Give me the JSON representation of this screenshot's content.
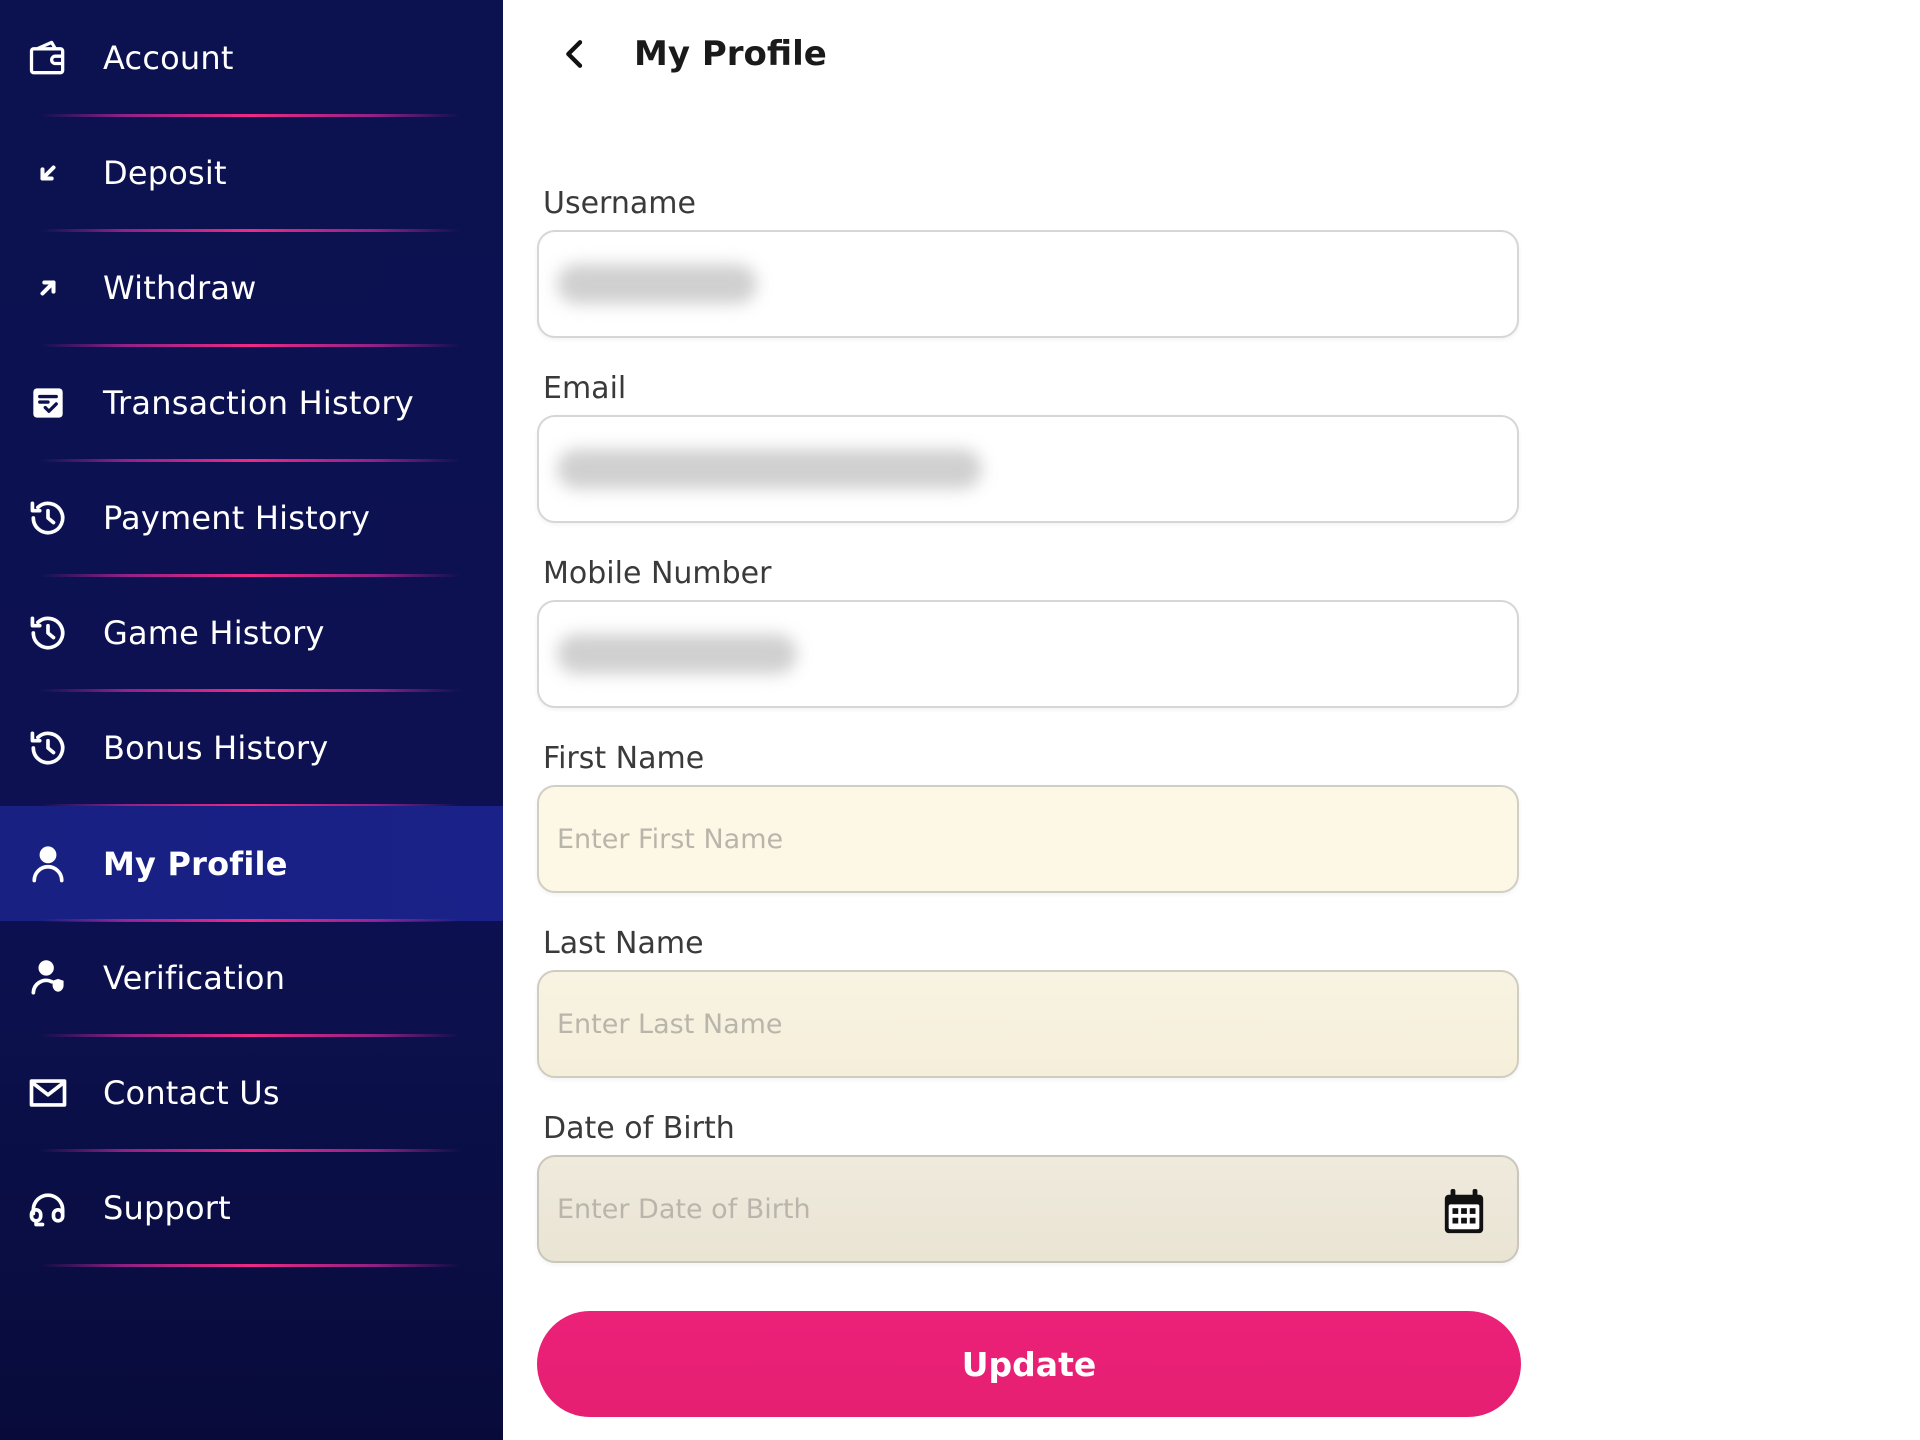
{
  "sidebar": {
    "active_item": "My Profile",
    "items": [
      {
        "label": "Account",
        "icon": "wallet-icon"
      },
      {
        "label": "Deposit",
        "icon": "arrow-down-left-icon"
      },
      {
        "label": "Withdraw",
        "icon": "arrow-up-right-icon"
      },
      {
        "label": "Transaction History",
        "icon": "receipt-check-icon"
      },
      {
        "label": "Payment History",
        "icon": "history-icon"
      },
      {
        "label": "Game History",
        "icon": "history-icon"
      },
      {
        "label": "Bonus History",
        "icon": "history-icon"
      },
      {
        "label": "My Profile",
        "icon": "user-icon"
      },
      {
        "label": "Verification",
        "icon": "user-shield-icon"
      },
      {
        "label": "Contact Us",
        "icon": "mail-icon"
      },
      {
        "label": "Support",
        "icon": "headset-icon"
      }
    ]
  },
  "header": {
    "back_icon": "chevron-left-icon",
    "title": "My Profile"
  },
  "form": {
    "username": {
      "label": "Username",
      "value": "[redacted]"
    },
    "email": {
      "label": "Email",
      "value": "[redacted]"
    },
    "mobile": {
      "label": "Mobile Number",
      "value": "[redacted]"
    },
    "first_name": {
      "label": "First Name",
      "placeholder": "Enter First Name",
      "value": ""
    },
    "last_name": {
      "label": "Last Name",
      "placeholder": "Enter Last Name",
      "value": ""
    },
    "dob": {
      "label": "Date of Birth",
      "placeholder": "Enter Date of Birth",
      "value": "",
      "icon": "calendar-icon"
    },
    "submit_label": "Update"
  },
  "colors": {
    "sidebar_bg": "#0c1150",
    "sidebar_active": "#182082",
    "divider_accent": "#ee2a86",
    "button_primary": "#e91e78"
  }
}
